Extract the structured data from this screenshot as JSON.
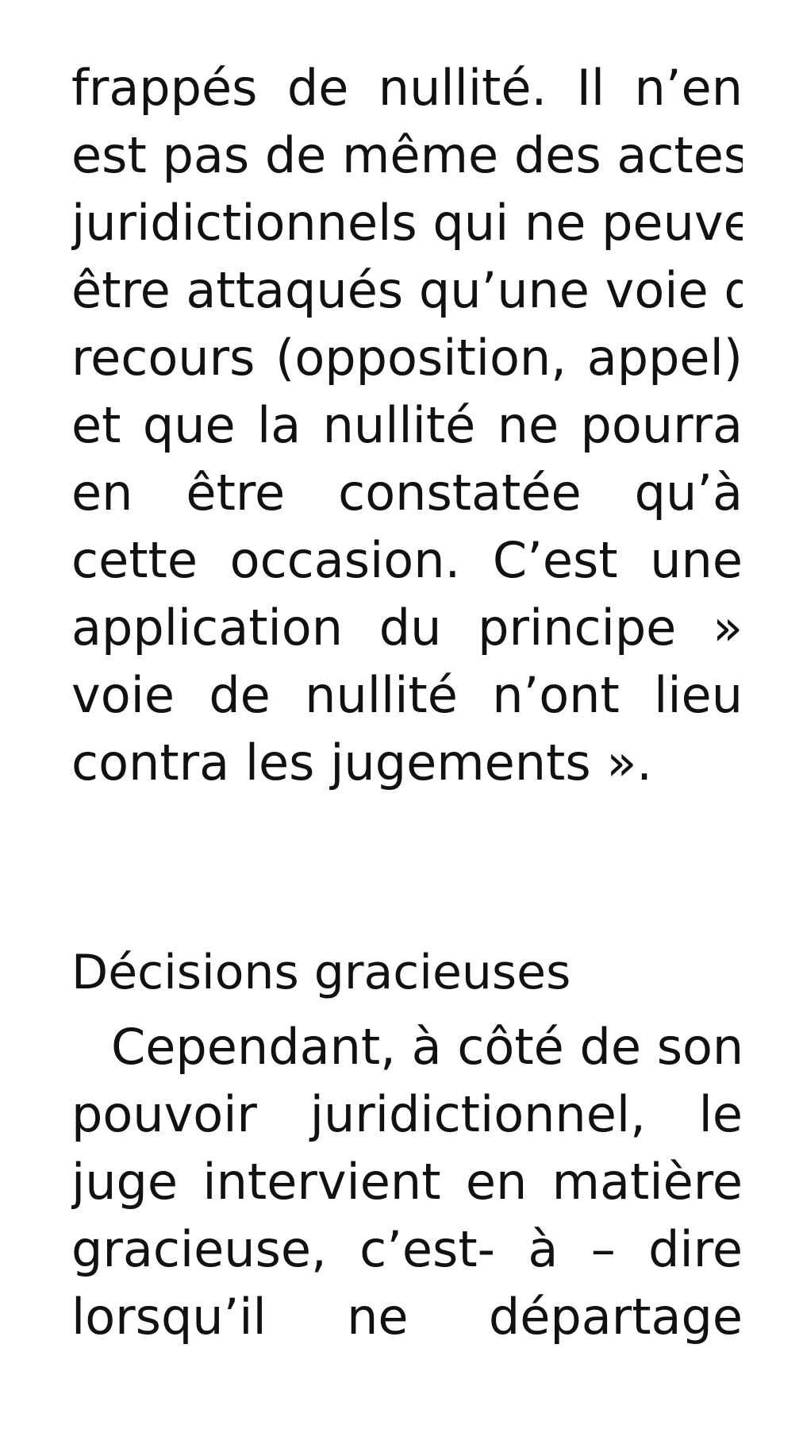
{
  "paragraph_1": {
    "lines": [
      "frappés de nullité. Il n’en",
      "est pas de même des actes",
      "juridictionnels qui ne peuvent",
      "être attaqués qu’une voie de",
      "recours (opposition, appel)",
      "et que la nullité ne pourra",
      "en être constatée qu’à",
      "cette occasion. C’est une",
      "application du principe »",
      "voie de nullité n’ont lieu",
      "contra les jugements »."
    ]
  },
  "section": {
    "heading": "Décisions gracieuses"
  },
  "paragraph_2": {
    "lines": [
      "Cependant, à côté de son",
      "pouvoir juridictionnel, le",
      "juge intervient en matière",
      "gracieuse, c’est- à – dire",
      "lorsqu’il ne départage"
    ]
  }
}
